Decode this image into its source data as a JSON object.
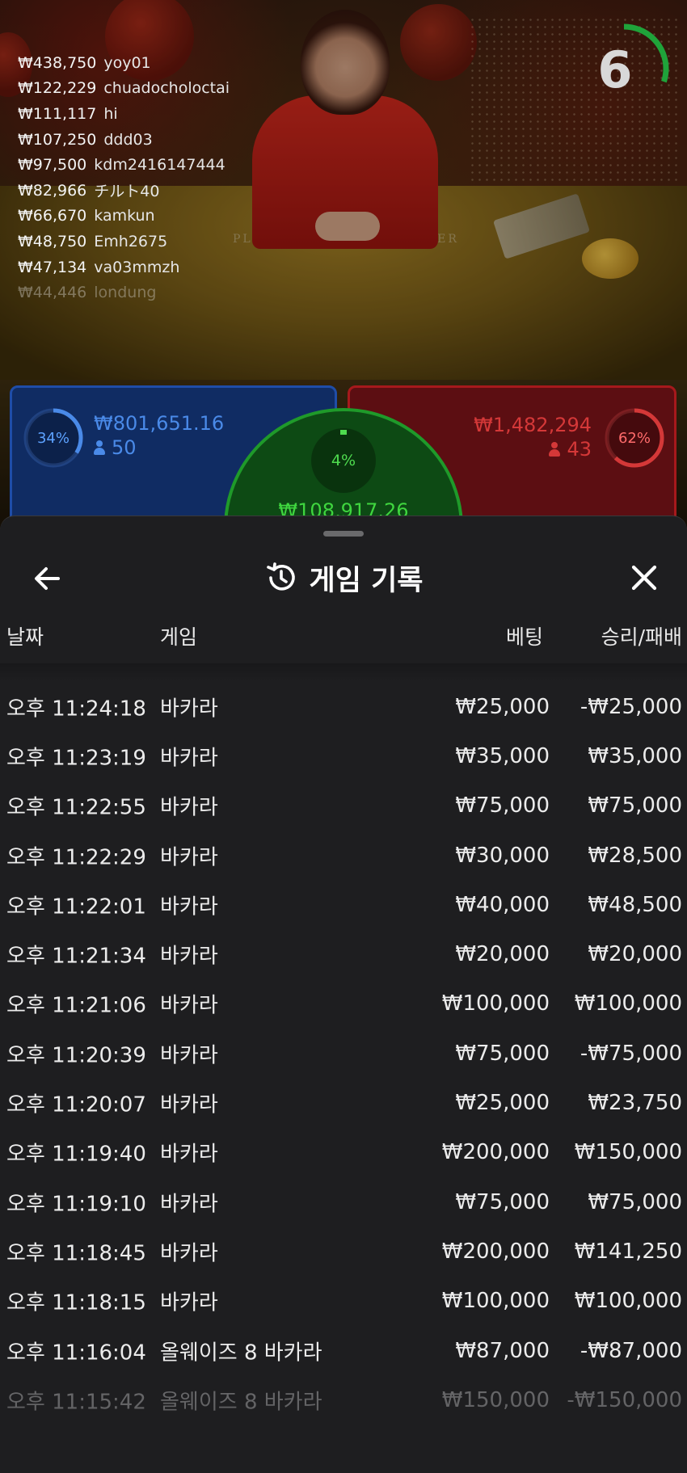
{
  "chat_feed": [
    {
      "amount": "₩438,750",
      "user": "yoy01"
    },
    {
      "amount": "₩122,229",
      "user": "chuadocholoctai"
    },
    {
      "amount": "₩111,117",
      "user": "hi"
    },
    {
      "amount": "₩107,250",
      "user": "ddd03"
    },
    {
      "amount": "₩97,500",
      "user": "kdm2416147444"
    },
    {
      "amount": "₩82,966",
      "user": "チルト40"
    },
    {
      "amount": "₩66,670",
      "user": "kamkun"
    },
    {
      "amount": "₩48,750",
      "user": "Emh2675"
    },
    {
      "amount": "₩47,134",
      "user": "va03mmzh"
    },
    {
      "amount": "₩44,446",
      "user": "londung"
    }
  ],
  "table_labels": {
    "player": "PLAYER",
    "banker": "BANKER"
  },
  "timer": {
    "value": "6",
    "progress": 0.3,
    "color": "#1fa33a"
  },
  "bets": {
    "player": {
      "percent": "34%",
      "percent_value": 0.34,
      "amount": "₩801,651.16",
      "count": "50",
      "color": "#4a8ae8"
    },
    "banker": {
      "percent": "62%",
      "percent_value": 0.62,
      "amount": "₩1,482,294",
      "count": "43",
      "color": "#d43838"
    },
    "tie": {
      "percent": "4%",
      "percent_value": 0.04,
      "amount": "₩108,917.26",
      "color": "#3fd63f"
    }
  },
  "sheet": {
    "title": "게임 기록",
    "columns": {
      "date": "날짜",
      "game": "게임",
      "bet": "베팅",
      "winloss": "승리/패배"
    },
    "rows": [
      {
        "time": "오후 11:24:18",
        "game": "바카라",
        "bet": "₩25,000",
        "winloss": "-₩25,000"
      },
      {
        "time": "오후 11:23:19",
        "game": "바카라",
        "bet": "₩35,000",
        "winloss": "₩35,000"
      },
      {
        "time": "오후 11:22:55",
        "game": "바카라",
        "bet": "₩75,000",
        "winloss": "₩75,000"
      },
      {
        "time": "오후 11:22:29",
        "game": "바카라",
        "bet": "₩30,000",
        "winloss": "₩28,500"
      },
      {
        "time": "오후 11:22:01",
        "game": "바카라",
        "bet": "₩40,000",
        "winloss": "₩48,500"
      },
      {
        "time": "오후 11:21:34",
        "game": "바카라",
        "bet": "₩20,000",
        "winloss": "₩20,000"
      },
      {
        "time": "오후 11:21:06",
        "game": "바카라",
        "bet": "₩100,000",
        "winloss": "₩100,000"
      },
      {
        "time": "오후 11:20:39",
        "game": "바카라",
        "bet": "₩75,000",
        "winloss": "-₩75,000"
      },
      {
        "time": "오후 11:20:07",
        "game": "바카라",
        "bet": "₩25,000",
        "winloss": "₩23,750"
      },
      {
        "time": "오후 11:19:40",
        "game": "바카라",
        "bet": "₩200,000",
        "winloss": "₩150,000"
      },
      {
        "time": "오후 11:19:10",
        "game": "바카라",
        "bet": "₩75,000",
        "winloss": "₩75,000"
      },
      {
        "time": "오후 11:18:45",
        "game": "바카라",
        "bet": "₩200,000",
        "winloss": "₩141,250"
      },
      {
        "time": "오후 11:18:15",
        "game": "바카라",
        "bet": "₩100,000",
        "winloss": "₩100,000"
      },
      {
        "time": "오후 11:16:04",
        "game": "올웨이즈 8 바카라",
        "bet": "₩87,000",
        "winloss": "-₩87,000"
      },
      {
        "time": "오후 11:15:42",
        "game": "올웨이즈 8 바카라",
        "bet": "₩150,000",
        "winloss": "-₩150,000"
      }
    ]
  },
  "icons": {
    "back": "arrow-left-icon",
    "history": "history-icon",
    "close": "close-icon",
    "person": "person-icon"
  }
}
